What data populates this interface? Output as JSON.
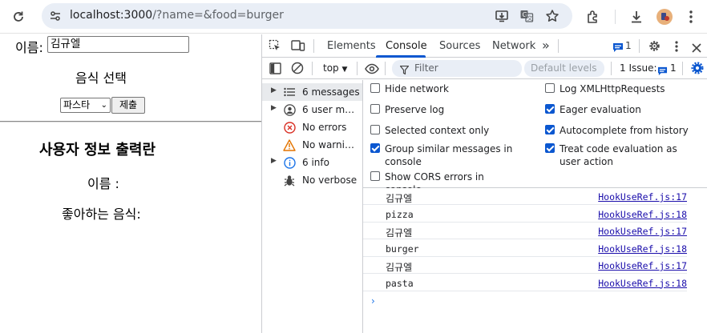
{
  "browser": {
    "url_host": "localhost:3000",
    "url_rest": "/?name=&food=burger"
  },
  "page": {
    "name_label": "이름:",
    "name_value": "김규엘",
    "food_heading": "음식 선택",
    "food_selected": "파스타",
    "submit_label": "제출",
    "info_title": "사용자 정보 출력란",
    "name_line": "이름 :",
    "food_line": "좋아하는 음식:"
  },
  "devtools": {
    "tabs": [
      "Elements",
      "Console",
      "Sources",
      "Network"
    ],
    "more_tabs": "»",
    "issue_badge_count": "1",
    "context": "top",
    "filter_placeholder": "Filter",
    "levels_label": "Default levels ▾",
    "issues_label": "1 Issue:",
    "issues_count": "1",
    "sidebar": [
      {
        "label": "6 messages",
        "icon": "list-icon",
        "arrow": true,
        "selected": true
      },
      {
        "label": "6 user me…",
        "icon": "user-icon",
        "arrow": true,
        "selected": false
      },
      {
        "label": "No errors",
        "icon": "error-icon",
        "arrow": false,
        "selected": false
      },
      {
        "label": "No warnin…",
        "icon": "warning-icon",
        "arrow": false,
        "selected": false
      },
      {
        "label": "6 info",
        "icon": "info-icon",
        "arrow": true,
        "selected": false
      },
      {
        "label": "No verbose",
        "icon": "bug-icon",
        "arrow": false,
        "selected": false
      }
    ],
    "settings_left": [
      {
        "label": "Hide network",
        "checked": false
      },
      {
        "label": "Preserve log",
        "checked": false
      },
      {
        "label": "Selected context only",
        "checked": false
      },
      {
        "label": "Group similar messages in console",
        "checked": true
      },
      {
        "label": "Show CORS errors in console",
        "checked": false
      }
    ],
    "settings_right": [
      {
        "label": "Log XMLHttpRequests",
        "checked": false
      },
      {
        "label": "Eager evaluation",
        "checked": true
      },
      {
        "label": "Autocomplete from history",
        "checked": true
      },
      {
        "label": "Treat code evaluation as user action",
        "checked": true
      }
    ],
    "log": [
      {
        "message": "김규엘",
        "source": "HookUseRef.js:17"
      },
      {
        "message": "pizza",
        "source": "HookUseRef.js:18"
      },
      {
        "message": "김규엘",
        "source": "HookUseRef.js:17"
      },
      {
        "message": "burger",
        "source": "HookUseRef.js:18"
      },
      {
        "message": "김규엘",
        "source": "HookUseRef.js:17"
      },
      {
        "message": "pasta",
        "source": "HookUseRef.js:18"
      }
    ],
    "prompt": "›"
  },
  "colors": {
    "accent": "#0b57d0",
    "link": "#1a0dab",
    "error": "#d93025",
    "warning": "#e37400",
    "info": "#1a73e8"
  }
}
